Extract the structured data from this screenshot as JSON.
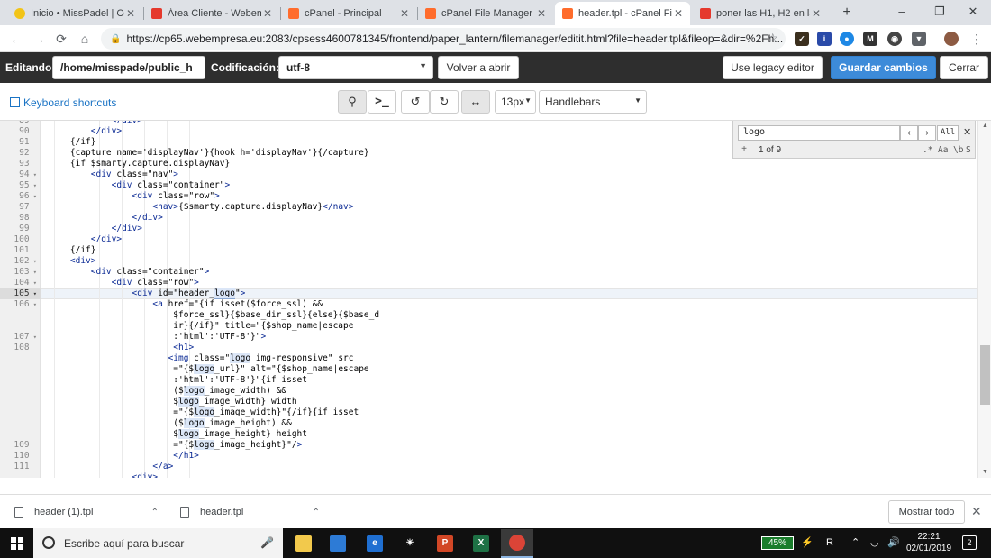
{
  "browser": {
    "tabs": [
      {
        "title": "Inicio • MissPadel | Cor",
        "favicon": "sun-favicon",
        "color": "#f2c417",
        "active": false
      },
      {
        "title": "Área Cliente - Webemp",
        "favicon": "webempresa-favicon",
        "color": "#e5392d",
        "active": false
      },
      {
        "title": "cPanel - Principal",
        "favicon": "cpanel-favicon",
        "color": "#ff6c2c",
        "active": false
      },
      {
        "title": "cPanel File Manager v3",
        "favicon": "cpanel-favicon",
        "color": "#ff6c2c",
        "active": false
      },
      {
        "title": "header.tpl - cPanel File",
        "favicon": "cpanel-favicon",
        "color": "#ff6c2c",
        "active": true
      },
      {
        "title": "poner las H1, H2 en la h",
        "favicon": "webempresa-favicon",
        "color": "#e5392d",
        "active": false
      }
    ],
    "url": "https://cp65.webempresa.eu:2083/cpsess4600781345/frontend/paper_lantern/filemanager/editit.html?file=header.tpl&fileop=&dir=%2Fh...",
    "extensions": [
      "extension-1",
      "extension-2",
      "extension-3",
      "extension-4",
      "extension-5",
      "extension-6",
      "profile-avatar"
    ]
  },
  "editbar": {
    "editing_label": "Editando:",
    "path": "/home/misspade/public_h",
    "encoding_label": "Codificación:",
    "encoding_value": "utf-8",
    "reopen_label": "Volver a abrir",
    "legacy_label": "Use legacy editor",
    "save_label": "Guardar cambios",
    "close_label": "Cerrar"
  },
  "toolbar": {
    "shortcuts_label": "Keyboard shortcuts",
    "font_size": "13px",
    "mode": "Handlebars"
  },
  "editor": {
    "search": {
      "query": "logo",
      "counter": "1 of 9",
      "all_label": "All",
      "regex_label": ".*",
      "case_label": "Aa",
      "word_label": "\\b",
      "selection_label": "S"
    },
    "gutter": [
      {
        "n": "89",
        "fold": false
      },
      {
        "n": "90",
        "fold": false
      },
      {
        "n": "91",
        "fold": false
      },
      {
        "n": "92",
        "fold": false
      },
      {
        "n": "93",
        "fold": false
      },
      {
        "n": "94",
        "fold": true
      },
      {
        "n": "95",
        "fold": true
      },
      {
        "n": "96",
        "fold": true
      },
      {
        "n": "97",
        "fold": false
      },
      {
        "n": "98",
        "fold": false
      },
      {
        "n": "99",
        "fold": false
      },
      {
        "n": "100",
        "fold": false
      },
      {
        "n": "101",
        "fold": false
      },
      {
        "n": "102",
        "fold": true
      },
      {
        "n": "103",
        "fold": true
      },
      {
        "n": "104",
        "fold": true
      },
      {
        "n": "105",
        "fold": true
      },
      {
        "n": "106",
        "fold": true
      },
      {
        "n": "",
        "fold": false
      },
      {
        "n": "",
        "fold": false
      },
      {
        "n": "107",
        "fold": true
      },
      {
        "n": "108",
        "fold": false
      },
      {
        "n": "",
        "fold": false
      },
      {
        "n": "",
        "fold": false
      },
      {
        "n": "",
        "fold": false
      },
      {
        "n": "",
        "fold": false
      },
      {
        "n": "",
        "fold": false
      },
      {
        "n": "",
        "fold": false
      },
      {
        "n": "",
        "fold": false
      },
      {
        "n": "",
        "fold": false
      },
      {
        "n": "109",
        "fold": false
      },
      {
        "n": "110",
        "fold": false
      },
      {
        "n": "111",
        "fold": false
      }
    ],
    "lines": [
      "            </div>",
      "        </div>",
      "    {/if}",
      "    {capture name='displayNav'}{hook h='displayNav'}{/capture}",
      "    {if $smarty.capture.displayNav}",
      "        <div class=\"nav\">",
      "            <div class=\"container\">",
      "                <div class=\"row\">",
      "                    <nav>{$smarty.capture.displayNav}</nav>",
      "                </div>",
      "            </div>",
      "        </div>",
      "    {/if}",
      "    <div>",
      "        <div class=\"container\">",
      "            <div class=\"row\">",
      "                <div id=\"header_logo\">",
      "                    <a href=\"{if isset($force_ssl) &&",
      "                        $force_ssl}{$base_dir_ssl}{else}{$base_d",
      "                        ir}{/if}\" title=\"{$shop_name|escape",
      "                        :'html':'UTF-8'}\">",
      "                        <h1>",
      "                       <img class=\"logo img-responsive\" src",
      "                        =\"{$logo_url}\" alt=\"{$shop_name|escape",
      "                        :'html':'UTF-8'}\"{if isset",
      "                        ($logo_image_width) &&",
      "                        $logo_image_width} width",
      "                        =\"{$logo_image_width}\"{/if}{if isset",
      "                        ($logo_image_height) &&",
      "                        $logo_image_height} height",
      "                        =\"{$logo_image_height}\"/>",
      "                        </h1>",
      "                    </a>",
      "                <div>"
    ],
    "active_line_index": 16
  },
  "downloads": {
    "items": [
      {
        "name": "header (1).tpl"
      },
      {
        "name": "header.tpl"
      }
    ],
    "show_all_label": "Mostrar todo"
  },
  "taskbar": {
    "search_placeholder": "Escribe aquí para buscar",
    "apps": [
      {
        "name": "file-explorer-icon",
        "color": "#f2c94c",
        "glyph": ""
      },
      {
        "name": "store-icon",
        "color": "#2d7bd6",
        "glyph": ""
      },
      {
        "name": "edge-icon",
        "color": "#1f6fd1",
        "glyph": "e"
      },
      {
        "name": "tips-icon",
        "color": "#ffffff",
        "glyph": ""
      },
      {
        "name": "powerpoint-icon",
        "color": "#d24726",
        "glyph": "P"
      },
      {
        "name": "excel-icon",
        "color": "#1e7145",
        "glyph": "X"
      },
      {
        "name": "chrome-icon",
        "color": "#db4437",
        "glyph": ""
      }
    ],
    "battery": "45%",
    "time": "22:21",
    "date": "02/01/2019",
    "notifications": "2"
  }
}
